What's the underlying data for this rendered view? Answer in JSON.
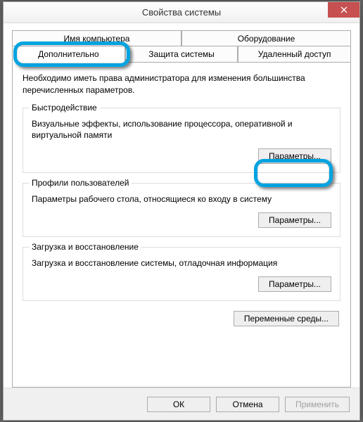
{
  "title": "Свойства системы",
  "tabs": {
    "row1": [
      {
        "label": "Имя компьютера"
      },
      {
        "label": "Оборудование"
      }
    ],
    "row2": [
      {
        "label": "Дополнительно",
        "active": true
      },
      {
        "label": "Защита системы"
      },
      {
        "label": "Удаленный доступ"
      }
    ]
  },
  "intro": "Необходимо иметь права администратора для изменения большинства перечисленных параметров.",
  "groups": {
    "performance": {
      "legend": "Быстродействие",
      "desc": "Визуальные эффекты, использование процессора, оперативной и виртуальной памяти",
      "button": "Параметры..."
    },
    "profiles": {
      "legend": "Профили пользователей",
      "desc": "Параметры рабочего стола, относящиеся ко входу в систему",
      "button": "Параметры..."
    },
    "startup": {
      "legend": "Загрузка и восстановление",
      "desc": "Загрузка и восстановление системы, отладочная информация",
      "button": "Параметры..."
    }
  },
  "envvar_button": "Переменные среды...",
  "footer": {
    "ok": "ОК",
    "cancel": "Отмена",
    "apply": "Применить"
  }
}
